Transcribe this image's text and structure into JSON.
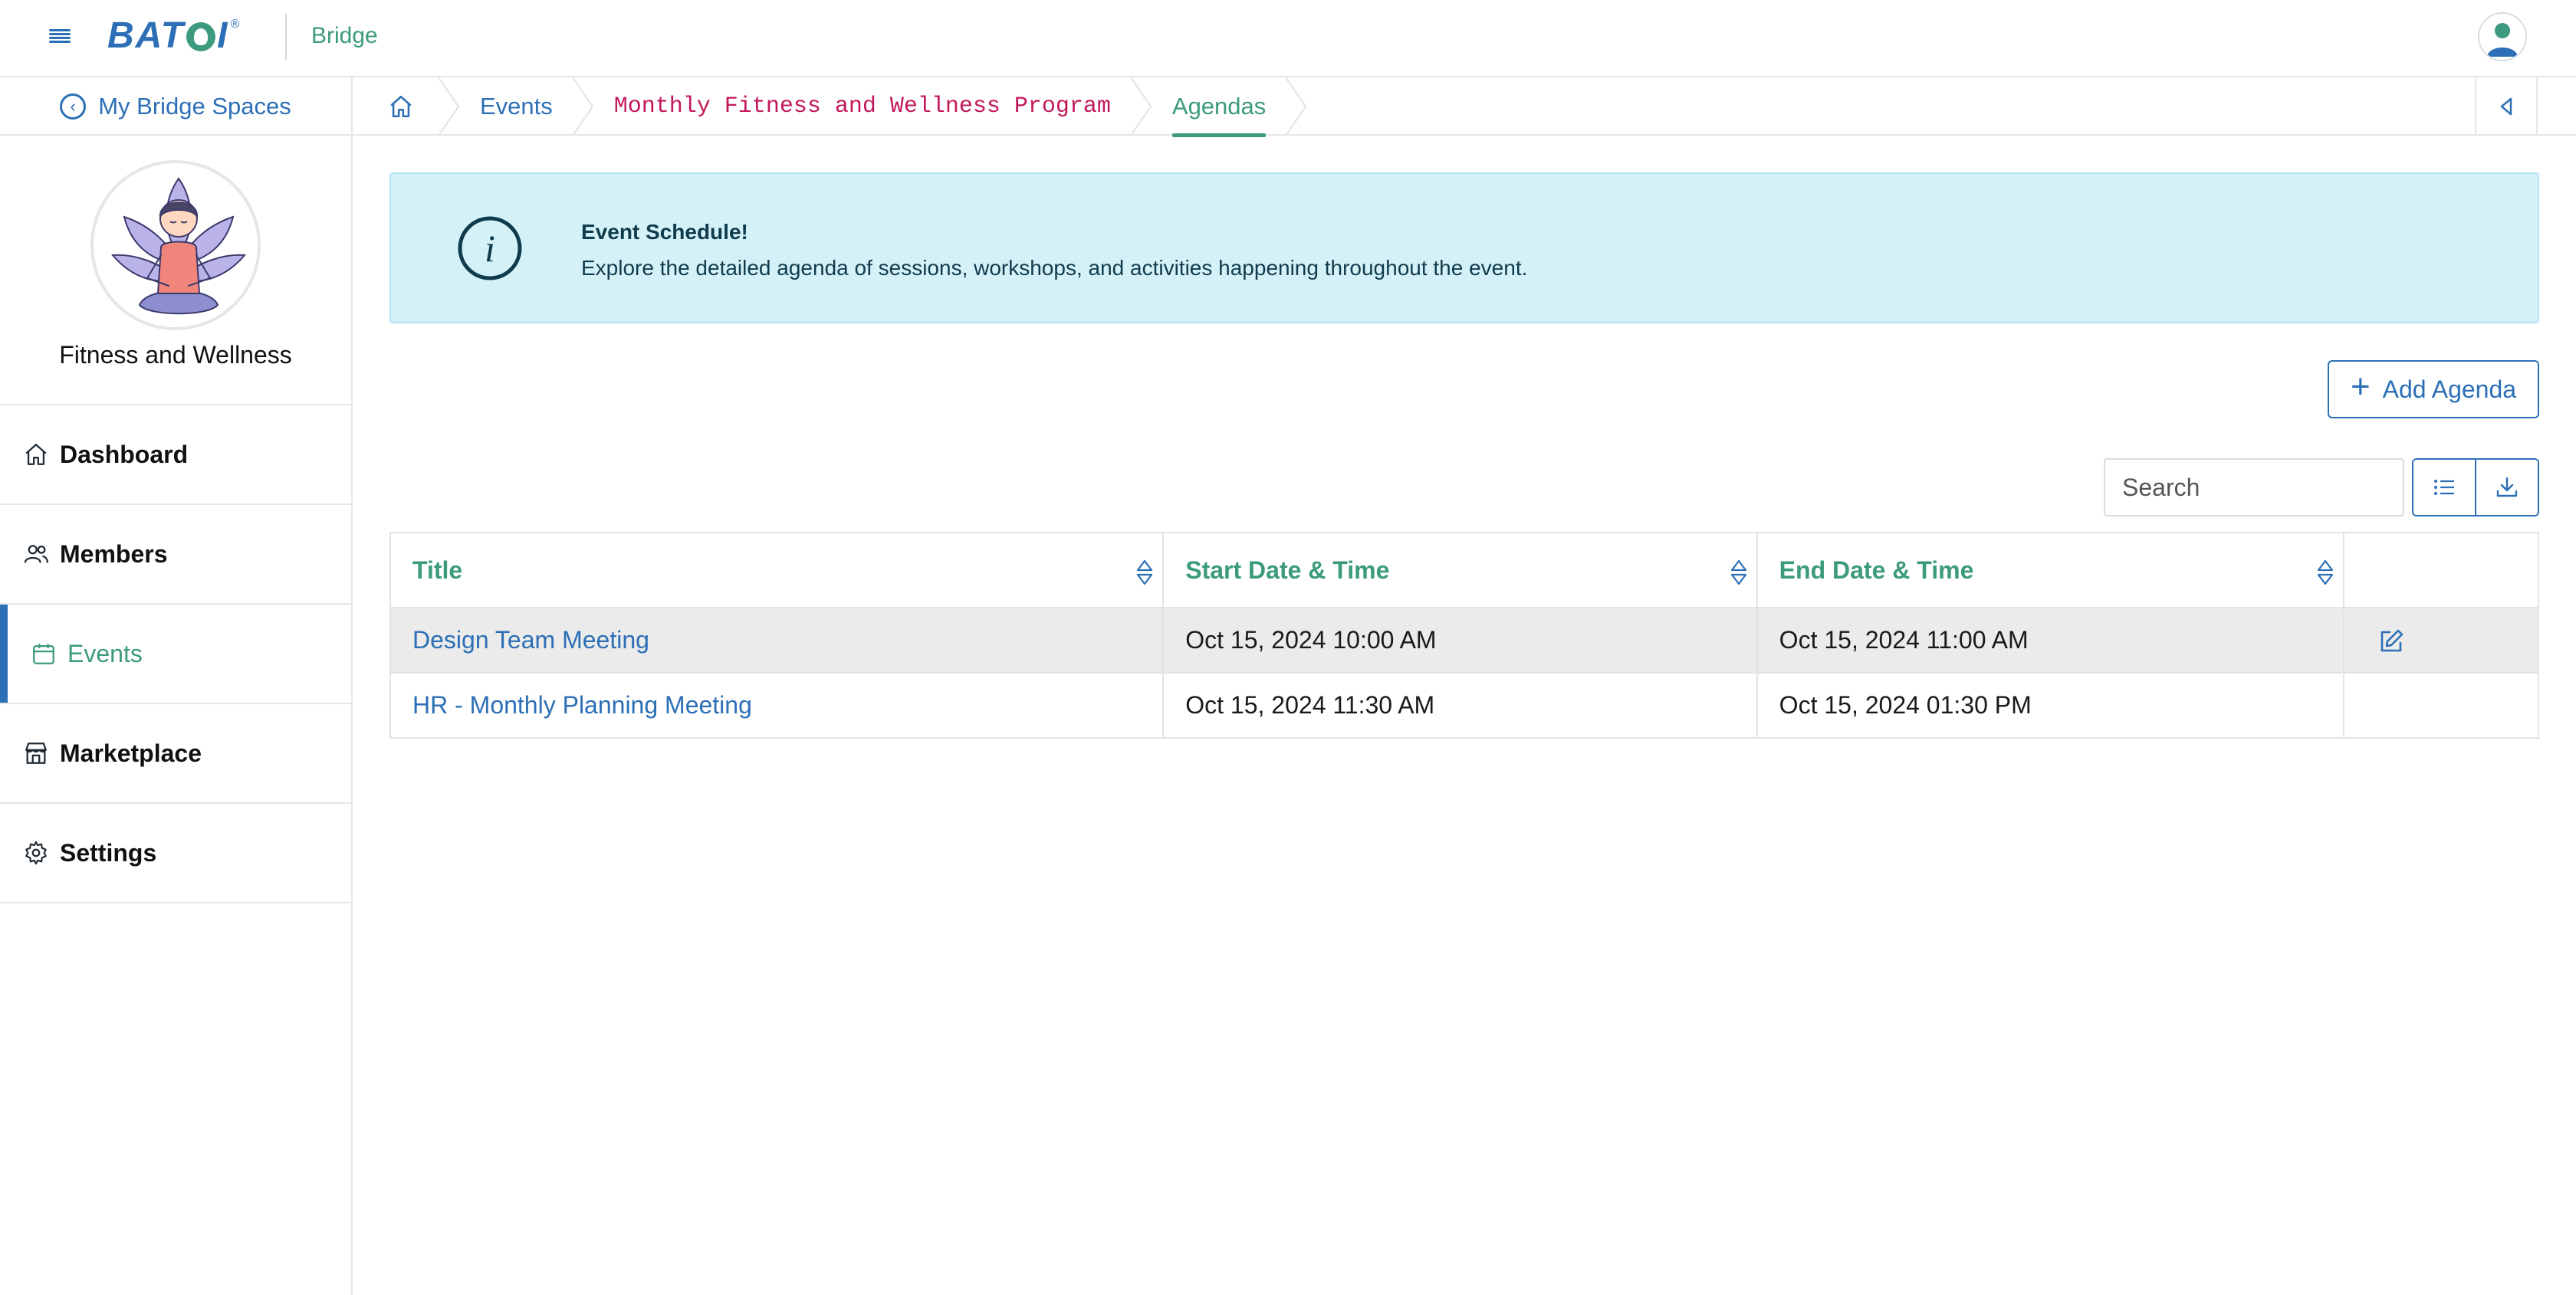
{
  "header": {
    "logo_text": "BAT",
    "logo_suffix": "I",
    "logo_reg": "®",
    "app_name": "Bridge"
  },
  "breadcrumb": {
    "back_link": "My Bridge Spaces",
    "items": [
      "Events",
      "Monthly Fitness and Wellness Program",
      "Agendas"
    ]
  },
  "sidebar": {
    "space_name": "Fitness and Wellness",
    "items": [
      {
        "label": "Dashboard",
        "icon": "home-icon"
      },
      {
        "label": "Members",
        "icon": "users-icon"
      },
      {
        "label": "Events",
        "icon": "calendar-icon",
        "active": true
      },
      {
        "label": "Marketplace",
        "icon": "store-icon"
      },
      {
        "label": "Settings",
        "icon": "gear-icon"
      }
    ]
  },
  "alert": {
    "title": "Event Schedule!",
    "text": "Explore the detailed agenda of sessions, workshops, and activities happening throughout the event."
  },
  "toolbar": {
    "add_label": "Add Agenda",
    "search_placeholder": "Search"
  },
  "table": {
    "columns": [
      "Title",
      "Start Date & Time",
      "End Date & Time"
    ],
    "rows": [
      {
        "title": "Design Team Meeting",
        "start": "Oct 15, 2024 10:00 AM",
        "end": "Oct 15, 2024 11:00 AM"
      },
      {
        "title": "HR - Monthly Planning Meeting",
        "start": "Oct 15, 2024 11:30 AM",
        "end": "Oct 15, 2024 01:30 PM"
      }
    ]
  },
  "colors": {
    "primary": "#2c6fb6",
    "accent": "#3c9a7e",
    "alert_bg": "#d5f1f8",
    "code_text": "#c2185b"
  }
}
